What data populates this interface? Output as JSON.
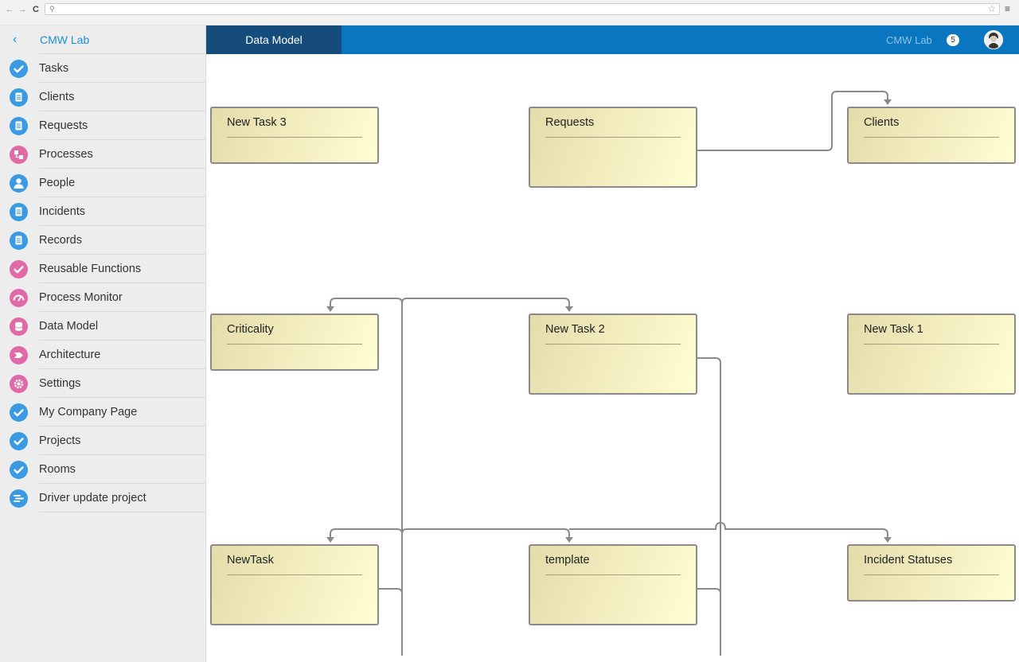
{
  "browser": {
    "back_glyph": "←",
    "forward_glyph": "→",
    "reload_glyph": "C",
    "search_glyph": "⚲",
    "star_glyph": "☆",
    "menu_glyph": "≡"
  },
  "sidebar": {
    "back_glyph": "‹",
    "title": "CMW Lab",
    "items": [
      {
        "label": "Tasks",
        "icon": "check-icon",
        "color": "#3a9be2"
      },
      {
        "label": "Clients",
        "icon": "document-icon",
        "color": "#3a9be2"
      },
      {
        "label": "Requests",
        "icon": "document-icon",
        "color": "#3a9be2"
      },
      {
        "label": "Processes",
        "icon": "process-icon",
        "color": "#e06aa8"
      },
      {
        "label": "People",
        "icon": "person-icon",
        "color": "#3a9be2"
      },
      {
        "label": "Incidents",
        "icon": "document-icon",
        "color": "#3a9be2"
      },
      {
        "label": "Records",
        "icon": "document-icon",
        "color": "#3a9be2"
      },
      {
        "label": "Reusable Functions",
        "icon": "check-icon",
        "color": "#e06aa8"
      },
      {
        "label": "Process Monitor",
        "icon": "gauge-icon",
        "color": "#e06aa8"
      },
      {
        "label": "Data Model",
        "icon": "database-icon",
        "color": "#e06aa8"
      },
      {
        "label": "Architecture",
        "icon": "architecture-icon",
        "color": "#e06aa8"
      },
      {
        "label": "Settings",
        "icon": "gear-icon",
        "color": "#e06aa8"
      },
      {
        "label": "My Company Page",
        "icon": "check-icon",
        "color": "#3a9be2"
      },
      {
        "label": "Projects",
        "icon": "check-icon",
        "color": "#3a9be2"
      },
      {
        "label": "Rooms",
        "icon": "check-icon",
        "color": "#3a9be2"
      },
      {
        "label": "Driver update project",
        "icon": "gantt-icon",
        "color": "#3a9be2"
      }
    ]
  },
  "header": {
    "active_tab": "Data Model",
    "workspace": "CMW Lab",
    "notification_count": "5",
    "accent": "#0a76bf",
    "active_tab_color": "#154c7c"
  },
  "diagram": {
    "entities": {
      "new_task_3": "New Task 3",
      "requests": "Requests",
      "clients": "Clients",
      "criticality": "Criticality",
      "new_task_2": "New Task 2",
      "new_task_1": "New Task 1",
      "newtask": "NewTask",
      "template": "template",
      "incident_statuses": "Incident Statuses"
    }
  }
}
